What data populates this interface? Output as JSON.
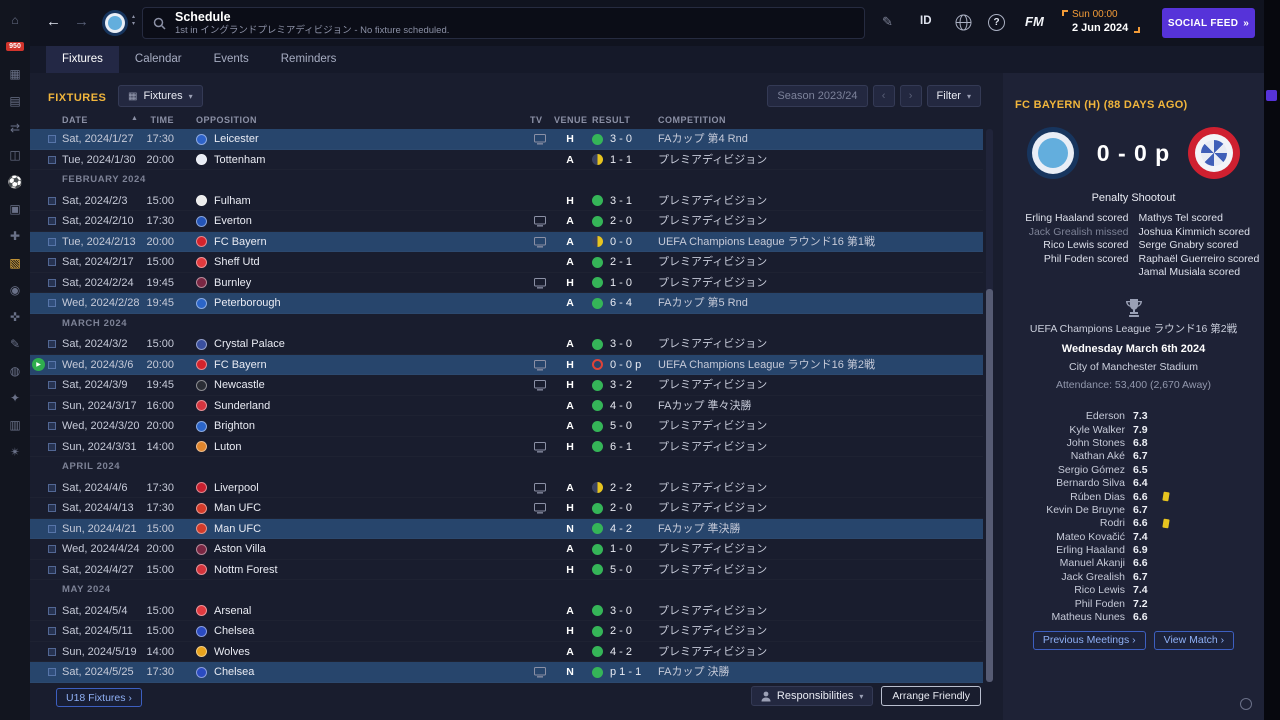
{
  "sidebar": {
    "icons": [
      {
        "name": "home",
        "glyph": "⌂"
      },
      {
        "name": "inbox",
        "glyph": "✉",
        "badge": "950"
      },
      {
        "name": "squad",
        "glyph": "▦"
      },
      {
        "name": "report",
        "glyph": "▤"
      },
      {
        "name": "transfers",
        "glyph": "⇄"
      },
      {
        "name": "training",
        "glyph": "◫"
      },
      {
        "name": "matches",
        "glyph": "⚽"
      },
      {
        "name": "competitions",
        "glyph": "▣"
      },
      {
        "name": "medical",
        "glyph": "✚"
      },
      {
        "name": "schedule",
        "glyph": "▧",
        "active": true
      },
      {
        "name": "club",
        "glyph": "◉"
      },
      {
        "name": "scouting",
        "glyph": "✜"
      },
      {
        "name": "notes",
        "glyph": "✎"
      },
      {
        "name": "finances",
        "glyph": "◍"
      },
      {
        "name": "league",
        "glyph": "✦"
      },
      {
        "name": "data-hub",
        "glyph": "▥"
      },
      {
        "name": "analysis",
        "glyph": "✴"
      }
    ]
  },
  "topbar": {
    "back": "←",
    "forward": "→",
    "switch_up": "▴",
    "switch_down": "▾",
    "title": "Schedule",
    "subtitle": "1st in イングランドプレミアディビジョン - No fixture scheduled.",
    "edit_glyph": "✎",
    "id_label": "ID",
    "help_label": "?",
    "fm_label": "FM",
    "clock_day": "Sun 00:00",
    "clock_date": "2 Jun 2024",
    "social_feed": "SOCIAL FEED",
    "social_chevrons": "»"
  },
  "tabs": [
    {
      "label": "Fixtures",
      "active": true
    },
    {
      "label": "Calendar"
    },
    {
      "label": "Events"
    },
    {
      "label": "Reminders"
    }
  ],
  "toolbar": {
    "section": "FIXTURES",
    "view_icon": "▦",
    "view": "Fixtures",
    "season": "Season 2023/24",
    "prev": "‹",
    "next": "›",
    "filter": "Filter",
    "caret": "▾",
    "sort_icon": "▲"
  },
  "table": {
    "columns": {
      "date": "DATE",
      "time": "TIME",
      "opposition": "OPPOSITION",
      "tv": "TV",
      "venue": "VENUE",
      "result": "RESULT",
      "competition": "COMPETITION"
    },
    "rows": [
      {
        "kind": "fixture",
        "date": "Sat, 2024/1/27",
        "time": "17:30",
        "opp": "Leicester",
        "color": "#2e63c9",
        "tv": true,
        "venue": "H",
        "outcome": "win",
        "result": "3 - 0",
        "comp": "FAカップ 第4 Rnd",
        "highlight": true
      },
      {
        "kind": "fixture",
        "date": "Tue, 2024/1/30",
        "time": "20:00",
        "opp": "Tottenham",
        "color": "#e9edf5",
        "tv": false,
        "venue": "A",
        "outcome": "draw",
        "result": "1 - 1",
        "comp": "プレミアディビジョン"
      },
      {
        "kind": "month",
        "label": "FEBRUARY 2024"
      },
      {
        "kind": "fixture",
        "date": "Sat, 2024/2/3",
        "time": "15:00",
        "opp": "Fulham",
        "color": "#ececec",
        "tv": false,
        "venue": "H",
        "outcome": "win",
        "result": "3 - 1",
        "comp": "プレミアディビジョン"
      },
      {
        "kind": "fixture",
        "date": "Sat, 2024/2/10",
        "time": "17:30",
        "opp": "Everton",
        "color": "#2455b8",
        "tv": true,
        "venue": "A",
        "outcome": "win",
        "result": "2 - 0",
        "comp": "プレミアディビジョン"
      },
      {
        "kind": "fixture",
        "date": "Tue, 2024/2/13",
        "time": "20:00",
        "opp": "FC Bayern",
        "color": "#d4232c",
        "tv": true,
        "venue": "A",
        "outcome": "draw",
        "result": "0 - 0",
        "comp": "UEFA Champions League ラウンド16 第1戦",
        "highlight": true
      },
      {
        "kind": "fixture",
        "date": "Sat, 2024/2/17",
        "time": "15:00",
        "opp": "Sheff Utd",
        "color": "#e23a3e",
        "tv": false,
        "venue": "A",
        "outcome": "win",
        "result": "2 - 1",
        "comp": "プレミアディビジョン"
      },
      {
        "kind": "fixture",
        "date": "Sat, 2024/2/24",
        "time": "19:45",
        "opp": "Burnley",
        "color": "#7a2743",
        "tv": true,
        "venue": "H",
        "outcome": "win",
        "result": "1 - 0",
        "comp": "プレミアディビジョン"
      },
      {
        "kind": "fixture",
        "date": "Wed, 2024/2/28",
        "time": "19:45",
        "opp": "Peterborough",
        "color": "#2b65c8",
        "tv": false,
        "venue": "A",
        "outcome": "win",
        "result": "6 - 4",
        "comp": "FAカップ 第5 Rnd",
        "highlight": true
      },
      {
        "kind": "month",
        "label": "MARCH 2024"
      },
      {
        "kind": "fixture",
        "date": "Sat, 2024/3/2",
        "time": "15:00",
        "opp": "Crystal Palace",
        "color": "#3a4f9e",
        "tv": false,
        "venue": "A",
        "outcome": "win",
        "result": "3 - 0",
        "comp": "プレミアディビジョン"
      },
      {
        "kind": "fixture",
        "date": "Wed, 2024/3/6",
        "time": "20:00",
        "opp": "FC Bayern",
        "color": "#d4232c",
        "tv": true,
        "venue": "H",
        "outcome": "losspens",
        "result": "0 - 0 p",
        "comp": "UEFA Champions League ラウンド16 第2戦",
        "highlight": true,
        "play": true
      },
      {
        "kind": "fixture",
        "date": "Sat, 2024/3/9",
        "time": "19:45",
        "opp": "Newcastle",
        "color": "#2a2d35",
        "tv": true,
        "venue": "H",
        "outcome": "win",
        "result": "3 - 2",
        "comp": "プレミアディビジョン"
      },
      {
        "kind": "fixture",
        "date": "Sun, 2024/3/17",
        "time": "16:00",
        "opp": "Sunderland",
        "color": "#d4353f",
        "tv": false,
        "venue": "A",
        "outcome": "win",
        "result": "4 - 0",
        "comp": "FAカップ 準々決勝"
      },
      {
        "kind": "fixture",
        "date": "Wed, 2024/3/20",
        "time": "20:00",
        "opp": "Brighton",
        "color": "#2b65c8",
        "tv": false,
        "venue": "A",
        "outcome": "win",
        "result": "5 - 0",
        "comp": "プレミアディビジョン"
      },
      {
        "kind": "fixture",
        "date": "Sun, 2024/3/31",
        "time": "14:00",
        "opp": "Luton",
        "color": "#e0862d",
        "tv": true,
        "venue": "H",
        "outcome": "win",
        "result": "6 - 1",
        "comp": "プレミアディビジョン"
      },
      {
        "kind": "month",
        "label": "APRIL 2024"
      },
      {
        "kind": "fixture",
        "date": "Sat, 2024/4/6",
        "time": "17:30",
        "opp": "Liverpool",
        "color": "#c8202f",
        "tv": true,
        "venue": "A",
        "outcome": "draw",
        "result": "2 - 2",
        "comp": "プレミアディビジョン"
      },
      {
        "kind": "fixture",
        "date": "Sat, 2024/4/13",
        "time": "17:30",
        "opp": "Man UFC",
        "color": "#d43b2a",
        "tv": true,
        "venue": "H",
        "outcome": "win",
        "result": "2 - 0",
        "comp": "プレミアディビジョン"
      },
      {
        "kind": "fixture",
        "date": "Sun, 2024/4/21",
        "time": "15:00",
        "opp": "Man UFC",
        "color": "#d43b2a",
        "tv": false,
        "venue": "N",
        "outcome": "win",
        "result": "4 - 2",
        "comp": "FAカップ 準決勝",
        "highlight": true
      },
      {
        "kind": "fixture",
        "date": "Wed, 2024/4/24",
        "time": "20:00",
        "opp": "Aston Villa",
        "color": "#7a2743",
        "tv": false,
        "venue": "A",
        "outcome": "win",
        "result": "1 - 0",
        "comp": "プレミアディビジョン"
      },
      {
        "kind": "fixture",
        "date": "Sat, 2024/4/27",
        "time": "15:00",
        "opp": "Nottm Forest",
        "color": "#d4343c",
        "tv": false,
        "venue": "H",
        "outcome": "win",
        "result": "5 - 0",
        "comp": "プレミアディビジョン"
      },
      {
        "kind": "month",
        "label": "MAY 2024"
      },
      {
        "kind": "fixture",
        "date": "Sat, 2024/5/4",
        "time": "15:00",
        "opp": "Arsenal",
        "color": "#e03a40",
        "tv": false,
        "venue": "A",
        "outcome": "win",
        "result": "3 - 0",
        "comp": "プレミアディビジョン"
      },
      {
        "kind": "fixture",
        "date": "Sat, 2024/5/11",
        "time": "15:00",
        "opp": "Chelsea",
        "color": "#2b4bc0",
        "tv": false,
        "venue": "H",
        "outcome": "win",
        "result": "2 - 0",
        "comp": "プレミアディビジョン"
      },
      {
        "kind": "fixture",
        "date": "Sun, 2024/5/19",
        "time": "14:00",
        "opp": "Wolves",
        "color": "#e8a31d",
        "tv": false,
        "venue": "A",
        "outcome": "win",
        "result": "4 - 2",
        "comp": "プレミアディビジョン"
      },
      {
        "kind": "fixture",
        "date": "Sat, 2024/5/25",
        "time": "17:30",
        "opp": "Chelsea",
        "color": "#2b4bc0",
        "tv": true,
        "venue": "N",
        "outcome": "winpens",
        "result": "p 1 - 1",
        "comp": "FAカップ 決勝",
        "highlight": true
      }
    ]
  },
  "footer": {
    "u18": "U18 Fixtures ›",
    "responsibilities": "Responsibilities",
    "arrange": "Arrange Friendly"
  },
  "match_panel": {
    "header": "FC BAYERN (H) (88 DAYS AGO)",
    "score": "0 - 0 p",
    "shootout_title": "Penalty Shootout",
    "home_shootout": [
      {
        "text": "Erling Haaland scored"
      },
      {
        "text": "Jack Grealish missed",
        "missed": true
      },
      {
        "text": "Rico Lewis scored"
      },
      {
        "text": "Phil Foden scored"
      }
    ],
    "away_shootout": [
      {
        "text": "Mathys Tel scored"
      },
      {
        "text": "Joshua Kimmich scored"
      },
      {
        "text": "Serge Gnabry scored"
      },
      {
        "text": "Raphaël Guerreiro scored"
      },
      {
        "text": "Jamal Musiala scored"
      }
    ],
    "competition": "UEFA Champions League ラウンド16 第2戦",
    "date": "Wednesday March 6th 2024",
    "stadium": "City of Manchester Stadium",
    "attendance": "Attendance: 53,400 (2,670 Away)",
    "ratings": [
      {
        "name": "Ederson",
        "rating": "7.3"
      },
      {
        "name": "Kyle Walker",
        "rating": "7.9"
      },
      {
        "name": "John Stones",
        "rating": "6.8"
      },
      {
        "name": "Nathan Aké",
        "rating": "6.7"
      },
      {
        "name": "Sergio Gómez",
        "rating": "6.5"
      },
      {
        "name": "Bernardo Silva",
        "rating": "6.4"
      },
      {
        "name": "Rúben Dias",
        "rating": "6.6",
        "card": true
      },
      {
        "name": "Kevin De Bruyne",
        "rating": "6.7"
      },
      {
        "name": "Rodri",
        "rating": "6.6",
        "card": true
      },
      {
        "name": "Mateo Kovačić",
        "rating": "7.4"
      },
      {
        "name": "Erling Haaland",
        "rating": "6.9"
      },
      {
        "name": "Manuel Akanji",
        "rating": "6.6"
      },
      {
        "name": "Jack Grealish",
        "rating": "6.7"
      },
      {
        "name": "Rico Lewis",
        "rating": "7.4"
      },
      {
        "name": "Phil Foden",
        "rating": "7.2"
      },
      {
        "name": "Matheus Nunes",
        "rating": "6.6"
      }
    ],
    "buttons": {
      "previous_meetings": "Previous Meetings ›",
      "view_match": "View Match ›"
    }
  },
  "colors": {
    "accent_gold": "#f2b63c",
    "win": "#35b558",
    "draw": "#e7c41f",
    "loss": "#df4338",
    "highlight_row": "#27456c",
    "social_purple": "#5633d9"
  }
}
